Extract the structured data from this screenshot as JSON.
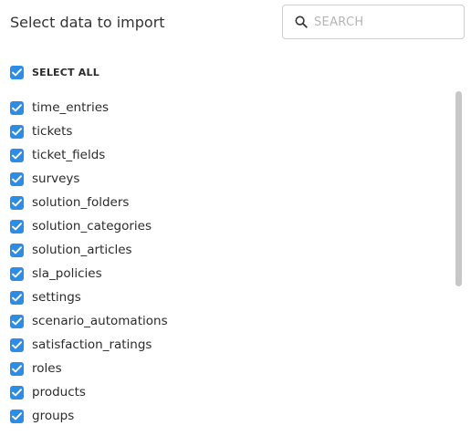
{
  "header": {
    "title": "Select data to import"
  },
  "search": {
    "placeholder": "SEARCH",
    "value": ""
  },
  "select_all": {
    "label": "SELECT ALL",
    "checked": true
  },
  "colors": {
    "checkbox_fill": "#2d8ce3",
    "scrollbar_thumb": "#c7c7c7"
  },
  "items": [
    {
      "label": "time_entries",
      "checked": true
    },
    {
      "label": "tickets",
      "checked": true
    },
    {
      "label": "ticket_fields",
      "checked": true
    },
    {
      "label": "surveys",
      "checked": true
    },
    {
      "label": "solution_folders",
      "checked": true
    },
    {
      "label": "solution_categories",
      "checked": true
    },
    {
      "label": "solution_articles",
      "checked": true
    },
    {
      "label": "sla_policies",
      "checked": true
    },
    {
      "label": "settings",
      "checked": true
    },
    {
      "label": "scenario_automations",
      "checked": true
    },
    {
      "label": "satisfaction_ratings",
      "checked": true
    },
    {
      "label": "roles",
      "checked": true
    },
    {
      "label": "products",
      "checked": true
    },
    {
      "label": "groups",
      "checked": true
    }
  ]
}
